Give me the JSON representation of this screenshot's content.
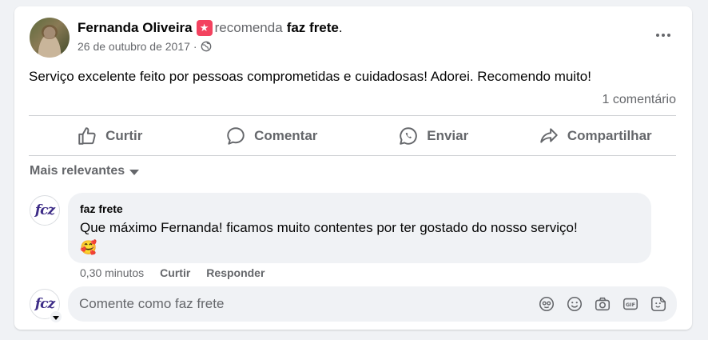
{
  "post": {
    "author": "Fernanda Oliveira",
    "recommends": "recomenda",
    "page": "faz frete",
    "period": ".",
    "date": "26 de outubro de 2017",
    "date_sep": "·",
    "text": "Serviço excelente feito por pessoas comprometidas e cuidadosas! Adorei. Recomendo muito!",
    "comment_count": "1 comentário"
  },
  "actions": {
    "like": "Curtir",
    "comment": "Comentar",
    "send": "Enviar",
    "share": "Compartilhar"
  },
  "comments": {
    "sort_label": "Mais relevantes",
    "items": [
      {
        "author": "faz frete",
        "text": "Que máximo Fernanda! ficamos muito contentes por ter gostado do nosso serviço!",
        "emoji": "🥰",
        "time": "0,30 minutos",
        "like": "Curtir",
        "reply": "Responder"
      }
    ]
  },
  "composer": {
    "placeholder": "Comente como faz frete",
    "avatar_text": "fcz"
  },
  "icons": {
    "recommend": "recommend-star-icon",
    "privacy": "globe-icon",
    "more": "more-options-icon"
  },
  "colors": {
    "recommend_badge": "#f3425f",
    "secondary_text": "#65676b",
    "brand_purple": "#3d2c87"
  }
}
